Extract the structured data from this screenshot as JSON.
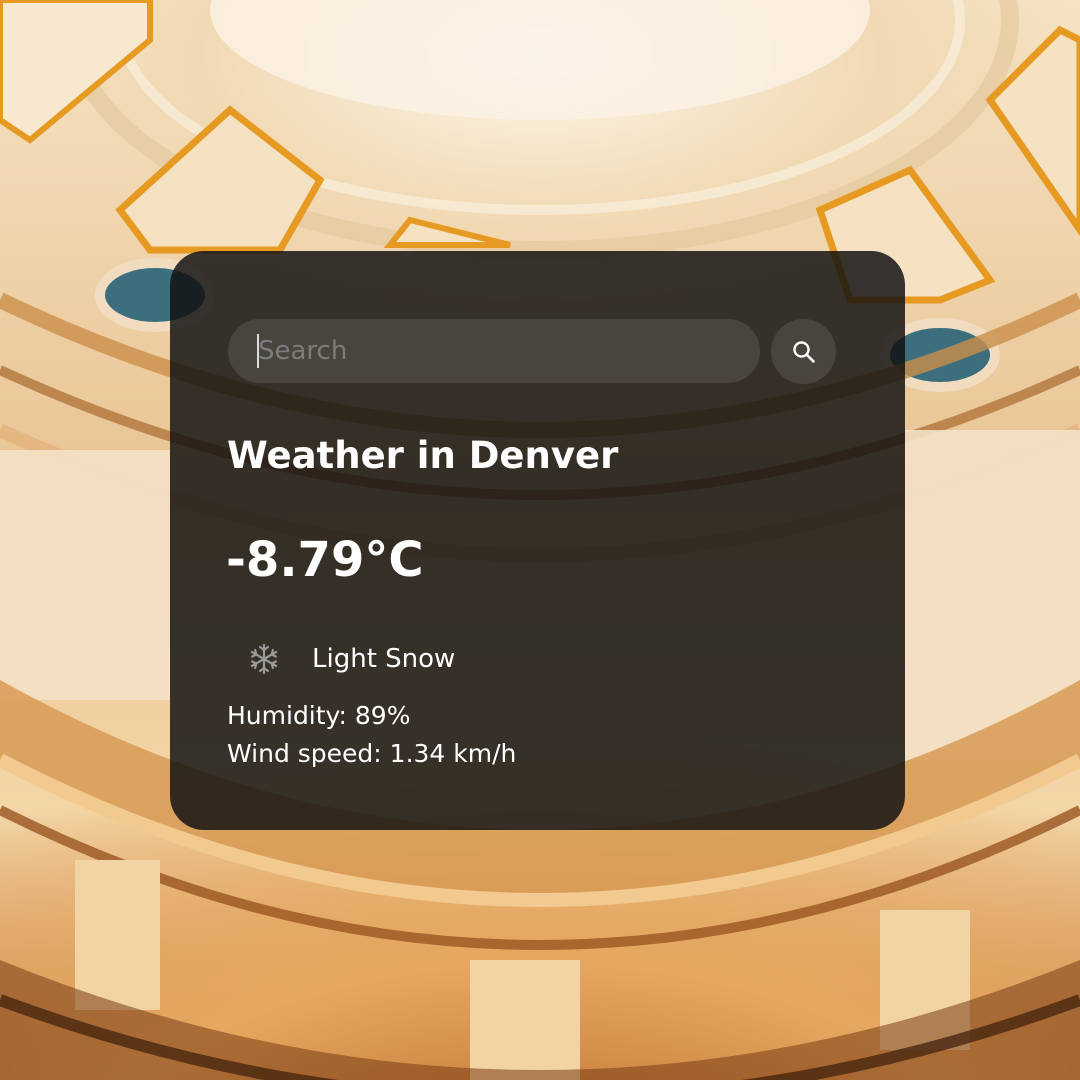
{
  "search": {
    "placeholder": "Search",
    "button_icon": "search-icon"
  },
  "weather": {
    "title": "Weather in Denver",
    "temperature": "-8.79°C",
    "condition_icon": "snowflake-icon",
    "condition": "Light Snow",
    "humidity": "Humidity: 89%",
    "wind": "Wind speed: 1.34 km/h"
  },
  "colors": {
    "card_background": "#101010",
    "text": "#ffffff",
    "background_accent": "#e89a2a"
  }
}
